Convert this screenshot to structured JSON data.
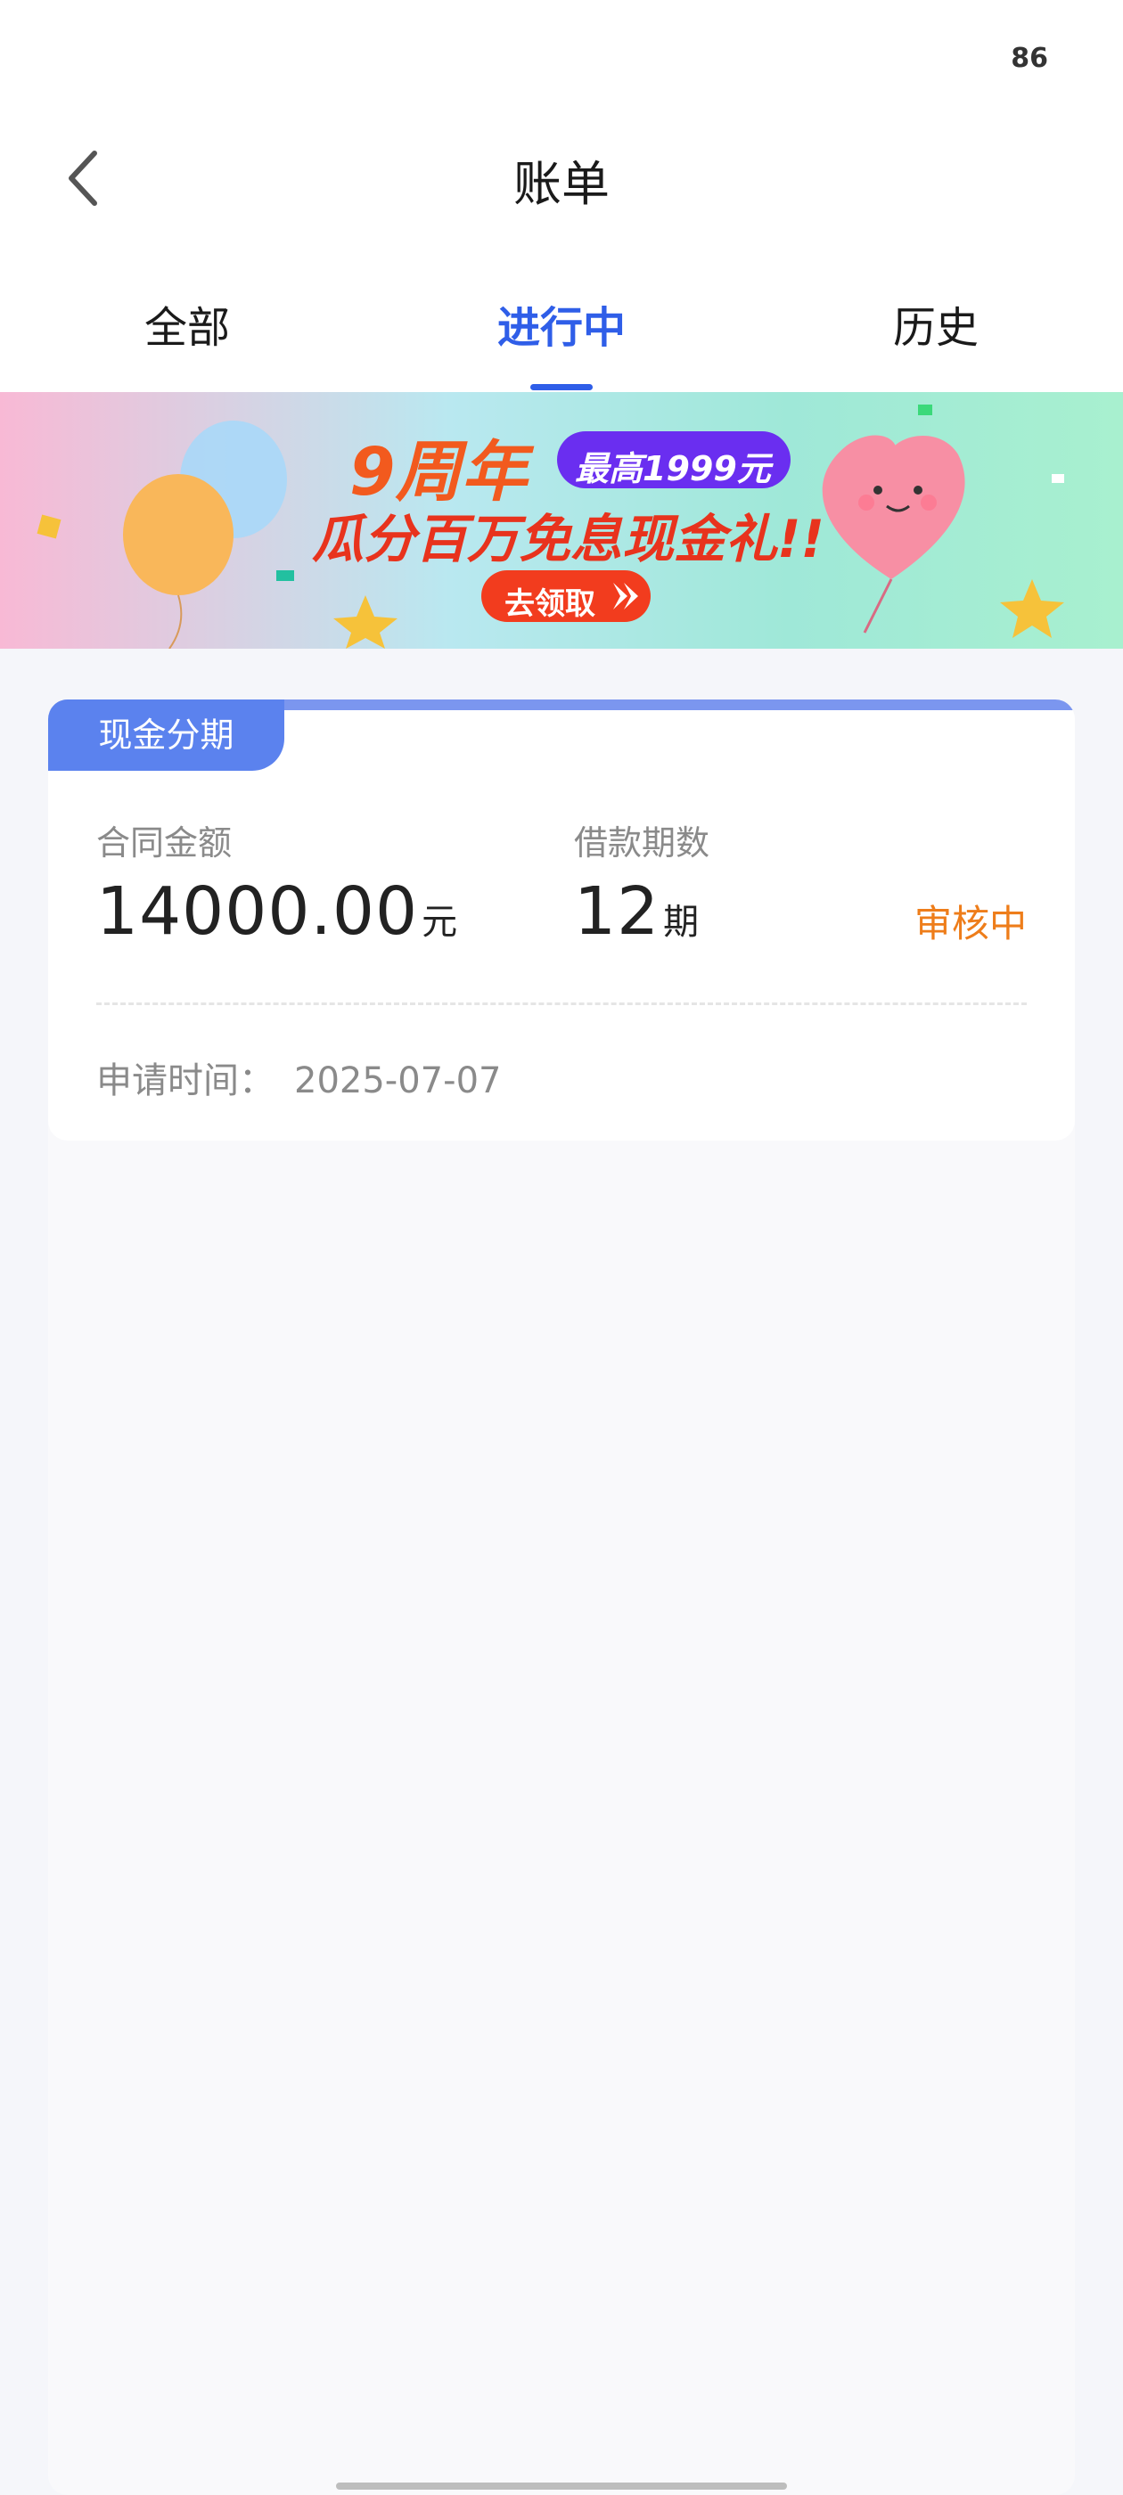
{
  "status_bar": {
    "battery": "86"
  },
  "header": {
    "title": "账单"
  },
  "tabs": [
    {
      "label": "全部",
      "active": false
    },
    {
      "label": "进行中",
      "active": true
    },
    {
      "label": "历史",
      "active": false
    }
  ],
  "banner": {
    "headline": "9周年",
    "badge": "最高1999元",
    "subline": "瓜分百万免息现金礼!!",
    "cta": "去领取"
  },
  "card": {
    "tag": "现金分期",
    "contract_amount_label": "合同金额",
    "contract_amount_value": "14000.00",
    "contract_amount_unit": "元",
    "term_label": "借款期数",
    "term_value": "12",
    "term_unit": "期",
    "status": "审核中",
    "apply_time_label": "申请时间：",
    "apply_time_value": "2025-07-07"
  },
  "colors": {
    "accent": "#2f5ee8",
    "tag_bg": "#5b82ee",
    "status_orange": "#ee7d1a",
    "cta_red": "#f23c1e"
  }
}
